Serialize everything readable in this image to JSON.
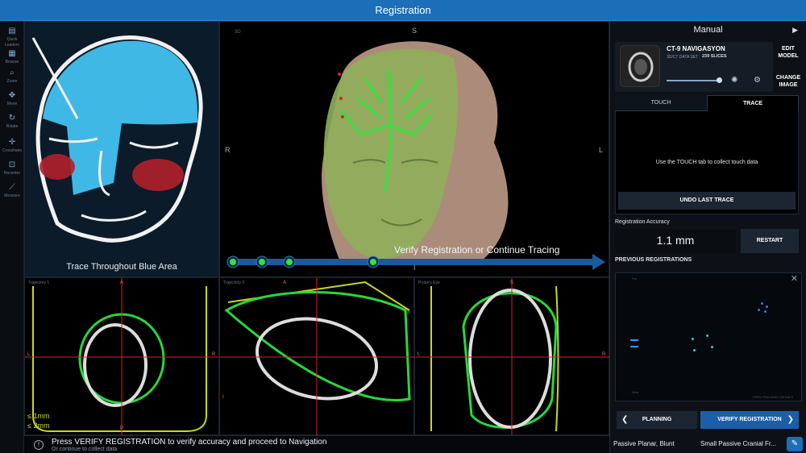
{
  "window": {
    "title": "Registration"
  },
  "toolrail": {
    "items": [
      {
        "label": "Quick Leaders",
        "icon": "quick-leaders-icon",
        "glyph": "▤"
      },
      {
        "label": "Browse",
        "icon": "browse-icon",
        "glyph": "▦"
      },
      {
        "label": "Zoom",
        "icon": "zoom-icon",
        "glyph": "⌕"
      },
      {
        "label": "Move",
        "icon": "move-icon",
        "glyph": "✥"
      },
      {
        "label": "Rotate",
        "icon": "rotate-icon",
        "glyph": "↻"
      },
      {
        "label": "Crosshairs",
        "icon": "crosshairs-icon",
        "glyph": "✛"
      },
      {
        "label": "Recenter",
        "icon": "recenter-icon",
        "glyph": "⊡"
      },
      {
        "label": "Measure",
        "icon": "measure-icon",
        "glyph": "⟋"
      }
    ]
  },
  "guide": {
    "caption": "Trace Throughout Blue Area"
  },
  "view3d": {
    "tag": "3D",
    "orient_top": "S",
    "orient_left": "R",
    "orient_right": "L",
    "orient_bottom": "I",
    "verify_text": "Verify Registration or Continue Tracing"
  },
  "slices": [
    {
      "title": "Trajectory 1",
      "top": "A",
      "bottom": "P",
      "left": "L",
      "right": "R"
    },
    {
      "title": "Trajectory 2",
      "top": "A",
      "bottom": "",
      "left": "I",
      "right": "S"
    },
    {
      "title": "Probe's Eye",
      "top": "S",
      "bottom": "I",
      "left": "L",
      "right": "R"
    }
  ],
  "legend": {
    "line1": "≤ 1mm",
    "line2": "≤ 2mm"
  },
  "status": {
    "main": "Press VERIFY REGISTRATION to verify accuracy and proceed to Navigation",
    "sub": "Or continue to collect data"
  },
  "right": {
    "mode": "Manual",
    "image": {
      "name": "CT-9 NAVIGASYON",
      "subtitle": "3D/CT DATA SET",
      "slices": "239 SLICES"
    },
    "edit_model": "EDIT MODEL",
    "change_image": "CHANGE IMAGE",
    "tabs": {
      "touch": "TOUCH",
      "trace": "TRACE"
    },
    "trace_message": "Use the TOUCH tab to collect touch data",
    "undo": "UNDO LAST TRACE",
    "reg_accuracy_label": "Registration Accuracy",
    "reg_accuracy_value": "1.1 mm",
    "restart": "RESTART",
    "previous_label": "PREVIOUS REGISTRATIONS",
    "plot": {
      "far": "Far",
      "near": "Near",
      "footer": "OPEN TRACKING DETAILS"
    },
    "planning": "PLANNING",
    "verify": "VERIFY REGISTRATION",
    "tool_a": "Passive Planar, Blunt",
    "tool_b": "Small Passive Cranial Fr..."
  },
  "colors": {
    "accent": "#1a6fb8",
    "mesh": "#35e040",
    "skin": "#c9a58f",
    "contour_green": "#26d83a",
    "contour_yellow": "#c8d820",
    "crosshair": "#e02020",
    "guide_blue": "#3fb8e6",
    "guide_red": "#b0202a",
    "points": "#29b8ff"
  }
}
